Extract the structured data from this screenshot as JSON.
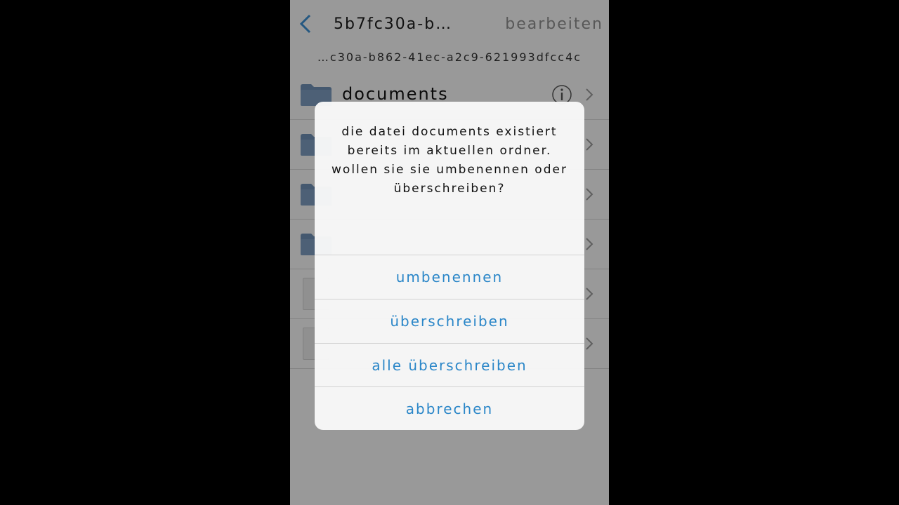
{
  "nav": {
    "back_icon": "chevron-left-icon",
    "title": "5B7FC30A-B…",
    "edit_label": "Bearbeiten"
  },
  "path": "…C30A-B862-41EC-A2C9-621993DFCC4C",
  "files": [
    {
      "name": "Documents",
      "icon": "folder-icon"
    }
  ],
  "dialog": {
    "message": "Die Datei Documents existiert bereits im aktuellen Ordner. Wollen Sie sie umbenennen oder überschreiben?",
    "buttons": {
      "rename": "Umbenennen",
      "overwrite": "Überschreiben",
      "overwrite_all": "Alle überschreiben",
      "cancel": "Abbrechen"
    }
  },
  "colors": {
    "accent": "#2a86c8",
    "folder": "#6f8fb3"
  }
}
